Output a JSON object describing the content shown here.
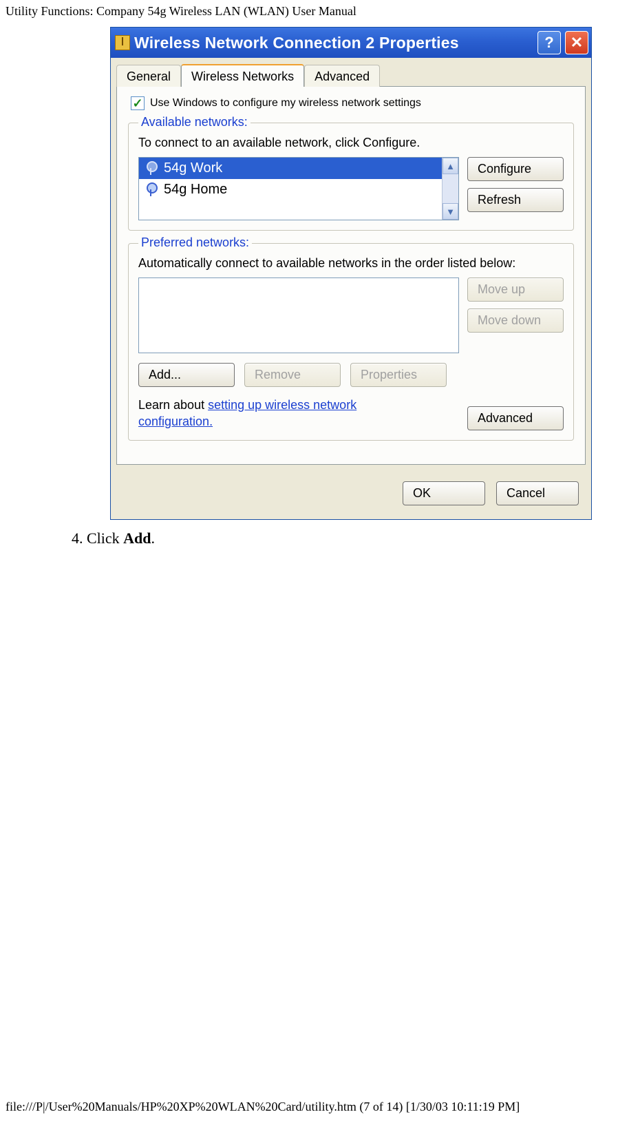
{
  "page_header": "Utility Functions: Company 54g Wireless LAN (WLAN) User Manual",
  "dialog": {
    "title": "Wireless Network Connection 2 Properties",
    "help_icon_label": "?",
    "close_icon_label": "✕",
    "tabs": {
      "general": "General",
      "wireless": "Wireless Networks",
      "advanced": "Advanced"
    },
    "use_windows_check": {
      "checked_glyph": "✓",
      "label": "Use Windows to configure my wireless network settings"
    },
    "available": {
      "legend": "Available networks:",
      "desc": "To connect to an available network, click Configure.",
      "items": [
        {
          "name": "54g Work",
          "selected": true
        },
        {
          "name": "54g Home",
          "selected": false
        }
      ],
      "configure": "Configure",
      "refresh": "Refresh",
      "scroll_up": "▲",
      "scroll_down": "▼"
    },
    "preferred": {
      "legend": "Preferred networks:",
      "desc": "Automatically connect to available networks in the order listed below:",
      "move_up": "Move up",
      "move_down": "Move down",
      "add": "Add...",
      "remove": "Remove",
      "properties": "Properties",
      "learn_prefix": "Learn about ",
      "learn_link": "setting up wireless network configuration.",
      "advanced": "Advanced"
    },
    "footer": {
      "ok": "OK",
      "cancel": "Cancel"
    }
  },
  "step": {
    "num": "4.",
    "pre": "  Click ",
    "bold": "Add",
    "post": "."
  },
  "page_footer": "file:///P|/User%20Manuals/HP%20XP%20WLAN%20Card/utility.htm (7 of 14) [1/30/03 10:11:19 PM]"
}
